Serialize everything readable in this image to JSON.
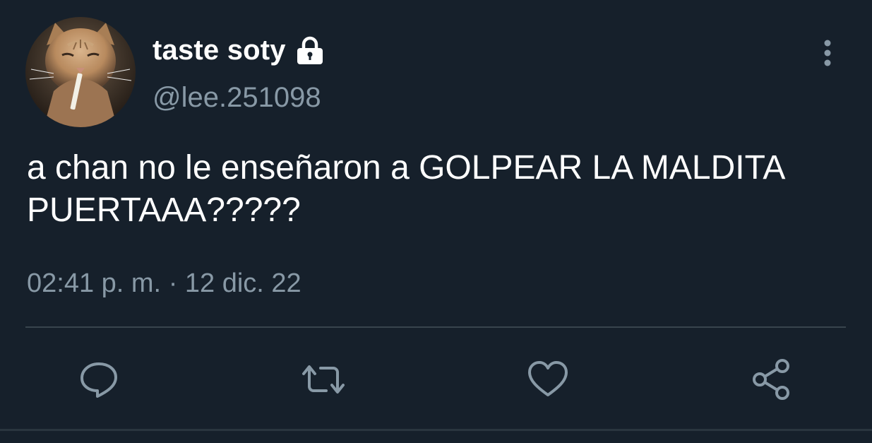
{
  "user": {
    "display_name": "taste soty",
    "handle": "@lee.251098",
    "protected": true
  },
  "tweet": {
    "text": "a chan no le enseñaron a GOLPEAR LA MALDITA PUERTAAA?????",
    "time": "02:41 p. m.",
    "separator": "·",
    "date": "12 dic. 22"
  },
  "icons": {
    "avatar": "cat-avatar-icon",
    "lock": "lock-icon",
    "more": "more-vertical-icon",
    "reply": "reply-icon",
    "retweet": "retweet-icon",
    "like": "heart-icon",
    "share": "share-icon"
  },
  "colors": {
    "background": "#16202b",
    "text_primary": "#ffffff",
    "text_secondary": "#8899a6",
    "divider": "#38444d"
  }
}
